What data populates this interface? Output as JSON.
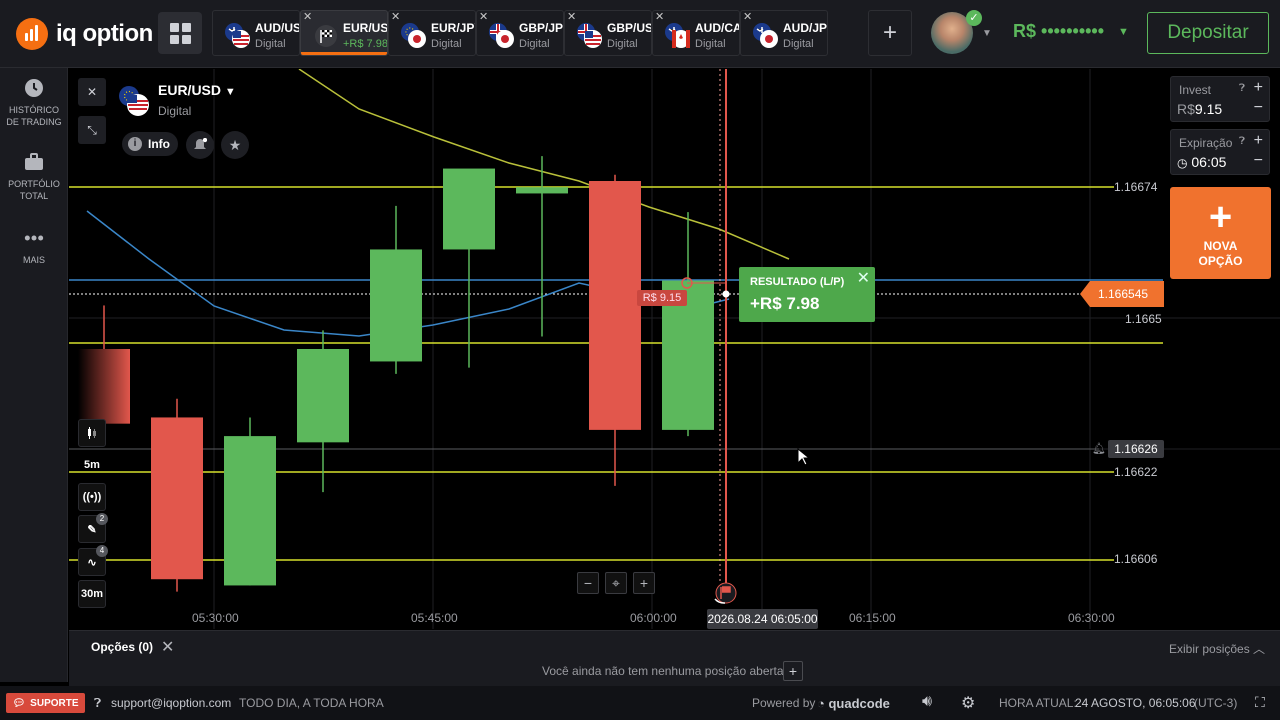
{
  "app": {
    "brand": "iq option",
    "accent_color": "#f56f12",
    "green": "#5cb85c",
    "red": "#e2574c"
  },
  "tabs": [
    {
      "pair": "AUD/USD",
      "sub": "Digital",
      "flags": [
        "au",
        "us"
      ]
    },
    {
      "pair": "EUR/USD",
      "sub": "+R$ 7.98",
      "flags": [
        "flag",
        ""
      ],
      "active": true
    },
    {
      "pair": "EUR/JPY",
      "sub": "Digital",
      "flags": [
        "eu",
        "jp"
      ]
    },
    {
      "pair": "GBP/JPY",
      "sub": "Digital",
      "flags": [
        "gb",
        "jp"
      ]
    },
    {
      "pair": "GBP/USD",
      "sub": "Digital",
      "flags": [
        "gb",
        "us"
      ]
    },
    {
      "pair": "AUD/CAD",
      "sub": "Digital",
      "flags": [
        "au",
        "ca"
      ]
    },
    {
      "pair": "AUD/JPY",
      "sub": "Digital",
      "flags": [
        "au",
        "jp"
      ]
    }
  ],
  "header": {
    "balance": "R$ ••••••••••",
    "deposit_label": "Depositar"
  },
  "sidebar": [
    {
      "icon": "clock-icon",
      "label": "HISTÓRICO DE TRADING"
    },
    {
      "icon": "briefcase-icon",
      "label": "PORTFÓLIO TOTAL"
    },
    {
      "icon": "more-icon",
      "label": "MAIS"
    }
  ],
  "asset": {
    "name": "EUR/USD",
    "type": "Digital",
    "info_label": "Info"
  },
  "right_panel": {
    "invest_label": "Invest",
    "invest_currency": "R$",
    "invest_value": "9.15",
    "expiry_label": "Expiração",
    "expiry_value": "06:05",
    "new_option_label": "NOVA OPÇÃO"
  },
  "price_levels": [
    "1.16674",
    "1.1665",
    "1.16622",
    "1.16606"
  ],
  "current_price": "1.166545",
  "alert_price": "1.16626",
  "result": {
    "label": "RESULTADO (L/P)",
    "value": "+R$ 7.98"
  },
  "bet_tag": "R$ 9.15",
  "time_axis": [
    "05:30:00",
    "05:45:00",
    "06:00:00",
    "06:15:00",
    "06:30:00"
  ],
  "expiry_datetime": "2026.08.24 06:05:00",
  "chart_tools": {
    "timeframe": "5m",
    "timeframe2": "30m",
    "drawing_badge": "2",
    "indicator_badge": "4"
  },
  "chart_data": {
    "type": "candlestick",
    "x": [
      "05:20",
      "05:25",
      "05:30",
      "05:35",
      "05:40",
      "05:45",
      "05:50",
      "05:55",
      "06:00",
      "06:05"
    ],
    "candles": [
      {
        "o": 1.16643,
        "h": 1.1665,
        "l": 1.16631,
        "c": 1.16631,
        "dir": "down"
      },
      {
        "o": 1.16632,
        "h": 1.16635,
        "l": 1.16604,
        "c": 1.16606,
        "dir": "down"
      },
      {
        "o": 1.16605,
        "h": 1.16632,
        "l": 1.16605,
        "c": 1.16629,
        "dir": "up"
      },
      {
        "o": 1.16628,
        "h": 1.16646,
        "l": 1.1662,
        "c": 1.16643,
        "dir": "up"
      },
      {
        "o": 1.16641,
        "h": 1.16666,
        "l": 1.16639,
        "c": 1.16659,
        "dir": "up"
      },
      {
        "o": 1.16659,
        "h": 1.1667,
        "l": 1.1664,
        "c": 1.16672,
        "dir": "up"
      },
      {
        "o": 1.16668,
        "h": 1.16674,
        "l": 1.16645,
        "c": 1.16669,
        "dir": "up"
      },
      {
        "o": 1.1667,
        "h": 1.16671,
        "l": 1.16621,
        "c": 1.1663,
        "dir": "down"
      },
      {
        "o": 1.1663,
        "h": 1.16665,
        "l": 1.16629,
        "c": 1.16654,
        "dir": "up"
      }
    ],
    "ylim": [
      1.16598,
      1.16688
    ]
  },
  "options_bar": {
    "title": "Opções (0)",
    "empty_text": "Você ainda não tem nenhuma posição aberta",
    "show_positions": "Exibir posições"
  },
  "footer": {
    "support_label": "SUPORTE",
    "email": "support@iqoption.com",
    "hours": "TODO DIA, A TODA HORA",
    "powered_by": "Powered by",
    "powered_brand": "quadcode",
    "time_label": "HORA ATUAL:",
    "time_value": "24 AGOSTO, 06:05:06",
    "tz": "(UTC-3)"
  }
}
